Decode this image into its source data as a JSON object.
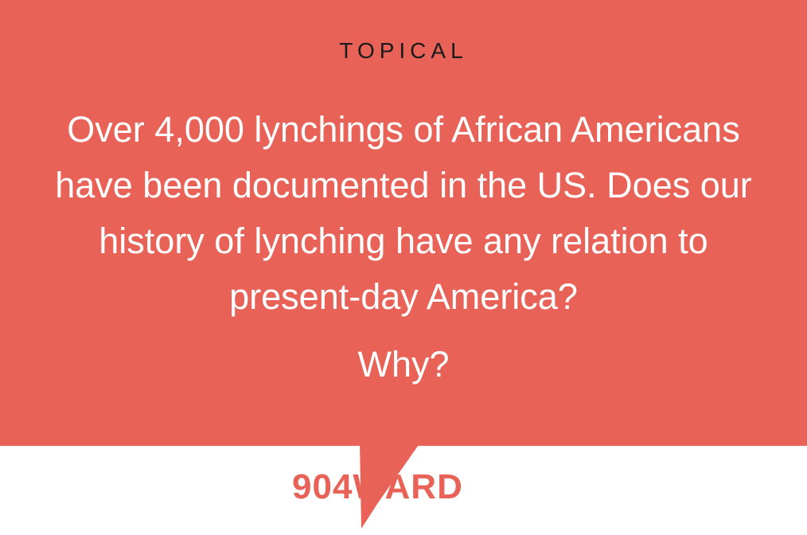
{
  "category": "TOPICAL",
  "question": "Over 4,000 lynchings of African Americans have been documented in the US. Does our history of lynching have any relation to present-day America?",
  "followup": "Why?",
  "logo": {
    "text": "904WARD"
  },
  "colors": {
    "accent": "#e86257",
    "background": "#ffffff",
    "label": "#1a1a1a",
    "text": "#ffffff"
  }
}
